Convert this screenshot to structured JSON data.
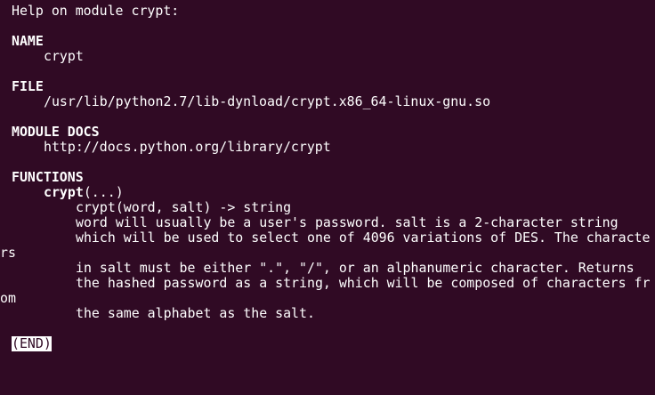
{
  "header": "Help on module crypt:",
  "sections": {
    "name_heading": "NAME",
    "name_value": "crypt",
    "file_heading": "FILE",
    "file_value": "/usr/lib/python2.7/lib-dynload/crypt.x86_64-linux-gnu.so",
    "docs_heading": "MODULE DOCS",
    "docs_value": "http://docs.python.org/library/crypt",
    "functions_heading": "FUNCTIONS"
  },
  "function": {
    "name": "crypt",
    "args": "(...)",
    "signature": "crypt(word, salt) -> string",
    "doc": [
      "word will usually be a user's password. salt is a 2-character string",
      "which will be used to select one of 4096 variations of DES. The characte",
      "rs",
      "in salt must be either \".\", \"/\", or an alphanumeric character. Returns",
      "the hashed password as a string, which will be composed of characters fr",
      "om",
      "the same alphabet as the salt."
    ]
  },
  "pager": {
    "end_marker": "(END)"
  }
}
